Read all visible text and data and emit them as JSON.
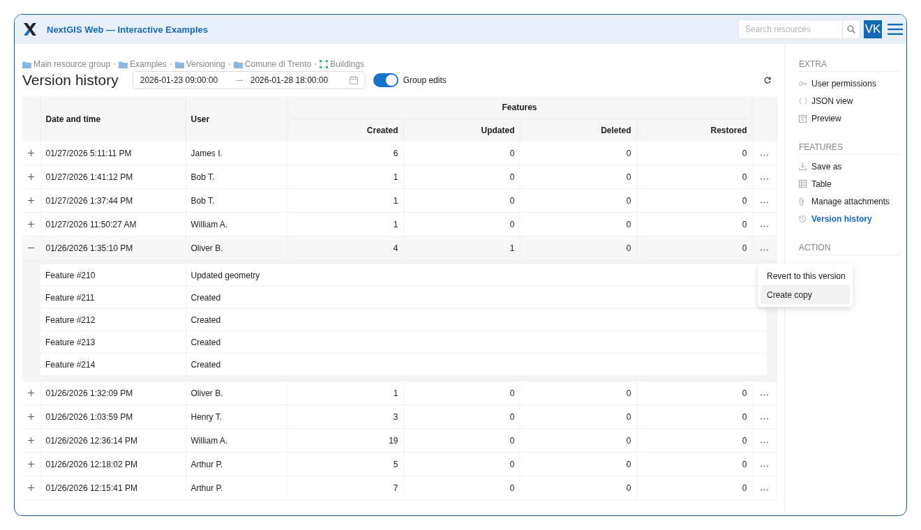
{
  "header": {
    "title": "NextGIS Web — Interactive Examples",
    "search": {
      "placeholder": "Search resources"
    },
    "avatar": "VK"
  },
  "breadcrumbs": [
    {
      "label": "Main resource group",
      "kind": "folder"
    },
    {
      "label": "Examples",
      "kind": "folder"
    },
    {
      "label": "Versioning",
      "kind": "folder"
    },
    {
      "label": "Comune di Trento",
      "kind": "folder"
    },
    {
      "label": "Buildings",
      "kind": "layer"
    }
  ],
  "page_title": "Version history",
  "date_range": {
    "start": "2026-01-23 09:00:00",
    "end": "2026-01-28 18:00:00"
  },
  "group_edits": {
    "label": "Group edits",
    "on": true
  },
  "table": {
    "columns": [
      "Date and time",
      "User"
    ],
    "group_header": "Features",
    "subcolumns": [
      "Created",
      "Updated",
      "Deleted",
      "Restored"
    ],
    "rows": [
      {
        "expanded": false,
        "date": "01/27/2026 5:11:11 PM",
        "user": "James I.",
        "values": [
          "6",
          "0",
          "0",
          "0"
        ]
      },
      {
        "expanded": false,
        "date": "01/27/2026 1:41:12 PM",
        "user": "Bob T.",
        "values": [
          "1",
          "0",
          "0",
          "0"
        ]
      },
      {
        "expanded": false,
        "date": "01/27/2026 1:37:44 PM",
        "user": "Bob T.",
        "values": [
          "1",
          "0",
          "0",
          "0"
        ]
      },
      {
        "expanded": false,
        "date": "01/27/2026 11:50:27 AM",
        "user": "William A.",
        "values": [
          "1",
          "0",
          "0",
          "0"
        ]
      },
      {
        "expanded": true,
        "date": "01/26/2026 1:35:10 PM",
        "user": "Oliver B.",
        "values": [
          "4",
          "1",
          "0",
          "0"
        ],
        "children": [
          {
            "feature": "Feature #210",
            "change": "Updated geometry"
          },
          {
            "feature": "Feature #211",
            "change": "Created"
          },
          {
            "feature": "Feature #212",
            "change": "Created"
          },
          {
            "feature": "Feature #213",
            "change": "Created"
          },
          {
            "feature": "Feature #214",
            "change": "Created"
          }
        ]
      },
      {
        "expanded": false,
        "date": "01/26/2026 1:32:09 PM",
        "user": "Oliver B.",
        "values": [
          "1",
          "0",
          "0",
          "0"
        ]
      },
      {
        "expanded": false,
        "date": "01/26/2026 1:03:59 PM",
        "user": "Henry T.",
        "values": [
          "3",
          "0",
          "0",
          "0"
        ]
      },
      {
        "expanded": false,
        "date": "01/26/2026 12:36:14 PM",
        "user": "William A.",
        "values": [
          "19",
          "0",
          "0",
          "0"
        ]
      },
      {
        "expanded": false,
        "date": "01/26/2026 12:18:02 PM",
        "user": "Arthur P.",
        "values": [
          "5",
          "0",
          "0",
          "0"
        ]
      },
      {
        "expanded": false,
        "date": "01/26/2026 12:15:41 PM",
        "user": "Arthur P.",
        "values": [
          "7",
          "0",
          "0",
          "0"
        ]
      }
    ]
  },
  "context_menu": {
    "items": [
      {
        "label": "Revert to this version",
        "selected": false
      },
      {
        "label": "Create copy",
        "selected": true
      }
    ]
  },
  "sidebar": {
    "sections": [
      {
        "title": "EXTRA",
        "items": [
          {
            "label": "User permissions",
            "selected": false
          },
          {
            "label": "JSON view",
            "selected": false
          },
          {
            "label": "Preview",
            "selected": false
          }
        ]
      },
      {
        "title": "FEATURES",
        "items": [
          {
            "label": "Save as",
            "selected": false
          },
          {
            "label": "Table",
            "selected": false
          },
          {
            "label": "Manage attachments",
            "selected": false
          },
          {
            "label": "Version history",
            "selected": true
          }
        ]
      },
      {
        "title": "ACTION"
      }
    ]
  }
}
